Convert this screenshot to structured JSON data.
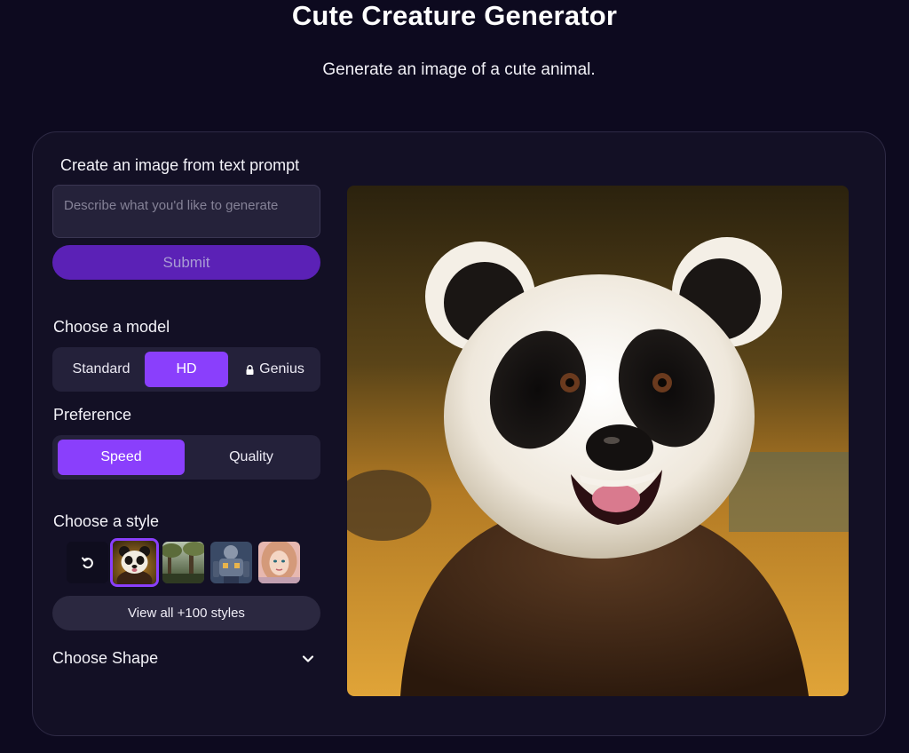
{
  "header": {
    "title": "Cute Creature Generator",
    "subtitle": "Generate an image of a cute animal."
  },
  "prompt": {
    "heading": "Create an image from text prompt",
    "placeholder": "Describe what you'd like to generate",
    "value": "",
    "submit_label": "Submit"
  },
  "model": {
    "heading": "Choose a model",
    "options": [
      "Standard",
      "HD",
      "Genius"
    ],
    "selected": "HD",
    "locked": [
      "Genius"
    ]
  },
  "preference": {
    "heading": "Preference",
    "options": [
      "Speed",
      "Quality"
    ],
    "selected": "Speed"
  },
  "style": {
    "heading": "Choose a style",
    "thumbnails": [
      "no-style-icon",
      "panda-style",
      "forest-style",
      "robot-style",
      "portrait-style"
    ],
    "selected": "panda-style",
    "view_all_label": "View all +100 styles"
  },
  "shape": {
    "heading": "Choose Shape"
  },
  "colors": {
    "accent": "#8a3ffc",
    "submit_bg": "#5b21b6",
    "background": "#0d0a1f",
    "card": "#131025"
  },
  "result": {
    "subject": "panda"
  }
}
